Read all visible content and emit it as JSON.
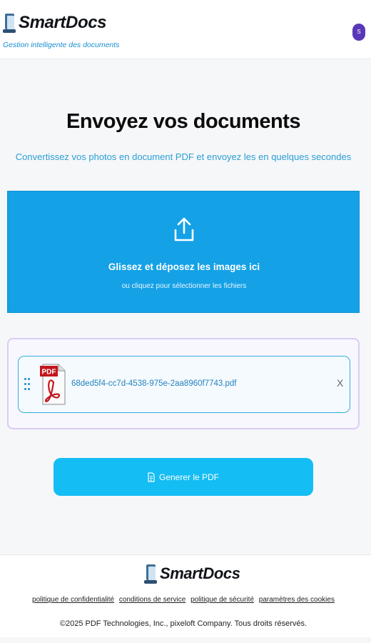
{
  "header": {
    "brand": "SmartDocs",
    "tagline": "Gestion intelligente des documents",
    "avatar_initial": "S",
    "icons": {
      "logo": "smartdocs-logo-icon"
    }
  },
  "main": {
    "title": "Envoyez vos documents",
    "subtitle": "Convertissez vos photos en document PDF et envoyez les en quelques secondes"
  },
  "dropzone": {
    "main_text": "Glissez et déposez les images ici",
    "sub_text": "ou cliquez pour sélectionner les fichiers",
    "icon": "upload-icon"
  },
  "files": [
    {
      "name": "68ded5f4-cc7d-4538-975e-2aa8960f7743.pdf",
      "type_label": "PDF",
      "remove_label": "X"
    }
  ],
  "actions": {
    "generate_label": "Generer le PDF",
    "generate_icon": "document-icon"
  },
  "footer": {
    "brand": "SmartDocs",
    "links": [
      "politique de confidentialité",
      "conditions de service",
      "politique de sécurité",
      "paramètres des cookies"
    ],
    "copyright": "©2025 PDF Technologies, Inc., pixeloft Company. Tous droits réservés."
  },
  "colors": {
    "accent": "#14a1e6",
    "button": "#14bdf3",
    "avatar": "#5a37b8",
    "panel_border": "#d9ccf4",
    "pdf_red": "#c4161c"
  }
}
